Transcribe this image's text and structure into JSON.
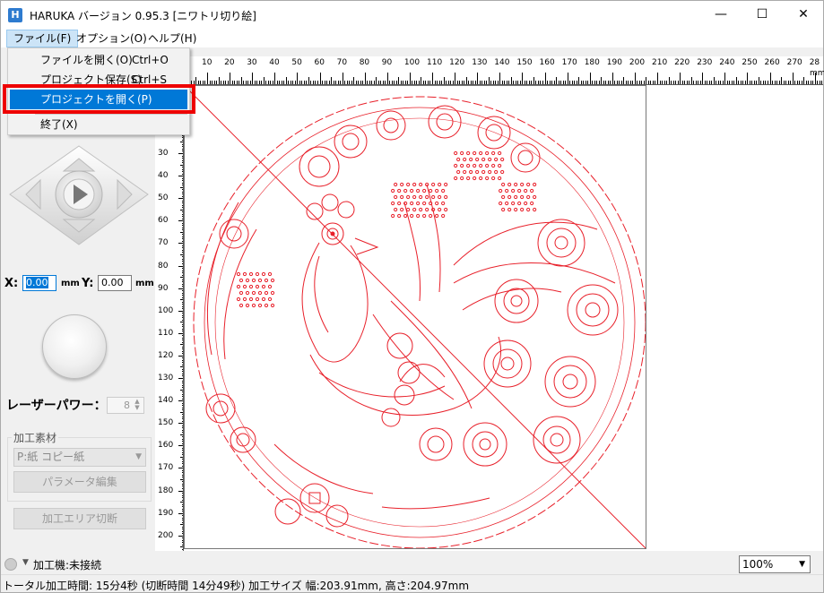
{
  "app": {
    "title": "HARUKA バージョン 0.95.3 [ニワトリ切り絵]",
    "icon_letter": "H"
  },
  "window_controls": {
    "minimize": "—",
    "maximize": "☐",
    "close": "✕"
  },
  "menu": {
    "items": [
      {
        "label": "ファイル(F)"
      },
      {
        "label": "オプション(O)"
      },
      {
        "label": "ヘルプ(H)"
      }
    ]
  },
  "file_menu": {
    "items": [
      {
        "label": "ファイルを開く(O)",
        "shortcut": "Ctrl+O"
      },
      {
        "label": "プロジェクト保存(S)",
        "shortcut": "Ctrl+S"
      },
      {
        "label": "プロジェクトを開く(P)",
        "shortcut": ""
      },
      {
        "label": "終了(X)",
        "shortcut": ""
      }
    ],
    "selected_index": 2
  },
  "position": {
    "x_label": "X:",
    "x_value": "0.00",
    "y_label": "Y:",
    "y_value": "0.00",
    "unit": "mm"
  },
  "laser": {
    "label": "レーザーパワー：",
    "value": "8"
  },
  "material": {
    "group_title": "加工素材",
    "selected": "P:紙 コピー紙",
    "edit_button": "パラメータ編集"
  },
  "cut_area_button": "加工エリア切断",
  "ruler": {
    "h_labels": [
      "10",
      "20",
      "30",
      "40",
      "50",
      "60",
      "70",
      "80",
      "90",
      "100",
      "110",
      "120",
      "130",
      "140",
      "150",
      "160",
      "170",
      "180",
      "190",
      "200",
      "210",
      "220",
      "230",
      "240",
      "250",
      "260",
      "270",
      "28"
    ],
    "v_labels": [
      "30",
      "40",
      "50",
      "60",
      "70",
      "80",
      "90",
      "100",
      "110",
      "120",
      "130",
      "140",
      "150",
      "160",
      "170",
      "180",
      "190",
      "200"
    ],
    "unit": "mm"
  },
  "connection": {
    "status": "加工機:未接続"
  },
  "zoom": {
    "value": "100%"
  },
  "status_bar": {
    "text": "トータル加工時間: 15分4秒 (切断時間 14分49秒)  加工サイズ 幅:203.91mm, 高さ:204.97mm"
  },
  "colors": {
    "accent": "#0078d7",
    "design_stroke": "#e8202a",
    "highlight_box": "#e00000"
  }
}
